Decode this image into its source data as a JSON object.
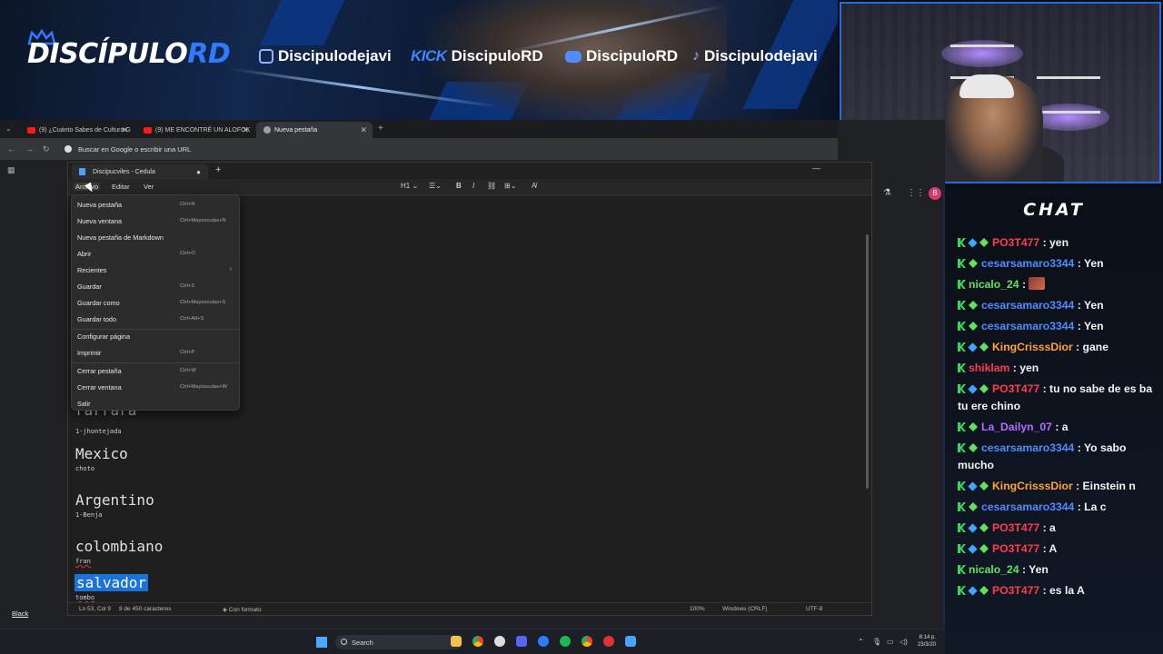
{
  "banner": {
    "logo_main": "DISCÍPULO",
    "logo_accent": "RD",
    "socials": [
      {
        "icon": "instagram-icon",
        "handle": "Discipulodejavi"
      },
      {
        "icon": "kick-icon",
        "label": "KICK",
        "handle": "DiscipuloRD"
      },
      {
        "icon": "youtube-icon",
        "handle": "DiscipuloRD"
      },
      {
        "icon": "tiktok-icon",
        "handle": "Discipulodejavi"
      }
    ]
  },
  "browser": {
    "tabs": [
      {
        "title": "(9) ¿Cuánto Sabes de Cultura G",
        "icon": "youtube-icon"
      },
      {
        "title": "(9) ME ENCONTRÉ UN ALOFOK",
        "icon": "youtube-icon"
      },
      {
        "title": "Nueva pestaña",
        "icon": "globe-icon"
      }
    ],
    "omnibox_placeholder": "Buscar en Google o escribir una URL"
  },
  "notepad": {
    "tab_title": "Discipucviles - Cedula",
    "menus": [
      "Archivo",
      "Editar",
      "Ver"
    ],
    "toolbar": {
      "heading": "H1"
    },
    "document": {
      "partial_heading": "rarrara",
      "lines": [
        {
          "heading": "Mexico",
          "sub": "choto"
        },
        {
          "heading": "Argentino",
          "sub": "1-Benja"
        },
        {
          "heading": "colombiano",
          "sub": "fran"
        },
        {
          "heading": "salvador",
          "sub": "tombo"
        }
      ],
      "first_sub": "1-jhontejada"
    },
    "status": {
      "position": "Ln 53, Col 9",
      "chars": "8 de 450 caracteres",
      "format": "Con formato",
      "zoom": "100%",
      "line_endings": "Windows (CRLF)",
      "encoding": "UTF-8"
    }
  },
  "file_menu": {
    "items": [
      {
        "label": "Nueva pestaña",
        "shortcut": "Ctrl+N"
      },
      {
        "label": "Nueva ventana",
        "shortcut": "Ctrl+Mayúsculas+N"
      },
      {
        "label": "Nueva pestaña de Markdown",
        "shortcut": ""
      },
      {
        "label": "Abrir",
        "shortcut": "Ctrl+O"
      },
      {
        "label": "Recientes",
        "shortcut": ""
      },
      {
        "label": "Guardar",
        "shortcut": "Ctrl+S"
      },
      {
        "label": "Guardar como",
        "shortcut": "Ctrl+Mayúsculas+S"
      },
      {
        "label": "Guardar todo",
        "shortcut": "Ctrl+Alt+S"
      },
      {
        "label": "Configurar página",
        "shortcut": ""
      },
      {
        "label": "Imprimir",
        "shortcut": "Ctrl+P"
      },
      {
        "label": "Cerrar pestaña",
        "shortcut": "Ctrl+W"
      },
      {
        "label": "Cerrar ventana",
        "shortcut": "Ctrl+Mayúsculas+W"
      },
      {
        "label": "Salir",
        "shortcut": ""
      }
    ]
  },
  "chat": {
    "title": "CHAT",
    "messages": [
      {
        "user": "PO3T477",
        "color": "#ff3b4e",
        "text": ": yen",
        "badges": [
          "kick",
          "cube",
          "gem"
        ]
      },
      {
        "user": "cesarsamaro3344",
        "color": "#4f8dff",
        "text": ": Yen",
        "badges": [
          "kick",
          "gem"
        ]
      },
      {
        "user": "nicalo_24",
        "color": "#5fe35f",
        "text": ":",
        "badges": [
          "kick"
        ],
        "emote": true
      },
      {
        "user": "cesarsamaro3344",
        "color": "#4f8dff",
        "text": ": Yen",
        "badges": [
          "kick",
          "gem"
        ]
      },
      {
        "user": "cesarsamaro3344",
        "color": "#4f8dff",
        "text": ": Yen",
        "badges": [
          "kick",
          "gem"
        ]
      },
      {
        "user": "KingCrisssDior",
        "color": "#ffa534",
        "text": ": gane",
        "badges": [
          "kick",
          "cube",
          "gem"
        ]
      },
      {
        "user": "shiklam",
        "color": "#ff3b4e",
        "text": ": yen",
        "badges": [
          "kick"
        ]
      },
      {
        "user": "PO3T477",
        "color": "#ff3b4e",
        "text": ": tu no sabe de es ba tu ere chino",
        "badges": [
          "kick",
          "cube",
          "gem"
        ]
      },
      {
        "user": "La_Dailyn_07",
        "color": "#b66cff",
        "text": ": a",
        "badges": [
          "kick",
          "gem"
        ]
      },
      {
        "user": "cesarsamaro3344",
        "color": "#4f8dff",
        "text": ": Yo sabo mucho",
        "badges": [
          "kick",
          "gem"
        ]
      },
      {
        "user": "KingCrisssDior",
        "color": "#ffa534",
        "text": ": Einstein n",
        "badges": [
          "kick",
          "cube",
          "gem"
        ]
      },
      {
        "user": "cesarsamaro3344",
        "color": "#4f8dff",
        "text": ": La c",
        "badges": [
          "kick",
          "gem"
        ]
      },
      {
        "user": "PO3T477",
        "color": "#ff3b4e",
        "text": ": a",
        "badges": [
          "kick",
          "cube",
          "gem"
        ]
      },
      {
        "user": "PO3T477",
        "color": "#ff3b4e",
        "text": ": A",
        "badges": [
          "kick",
          "cube",
          "gem"
        ]
      },
      {
        "user": "nicalo_24",
        "color": "#5fe35f",
        "text": ": Yen",
        "badges": [
          "kick"
        ]
      },
      {
        "user": "PO3T477",
        "color": "#ff3b4e",
        "text": ": es la A",
        "badges": [
          "kick",
          "cube",
          "gem"
        ]
      }
    ]
  },
  "desktop": {
    "bottom_link": "Black",
    "taskbar_search": "Search",
    "clock_time": "8:14 p.",
    "clock_date": "23/3/20"
  },
  "colors": {
    "accent": "#2e7bff",
    "selection": "#1a73d9",
    "kick_green": "#3bd35f"
  }
}
